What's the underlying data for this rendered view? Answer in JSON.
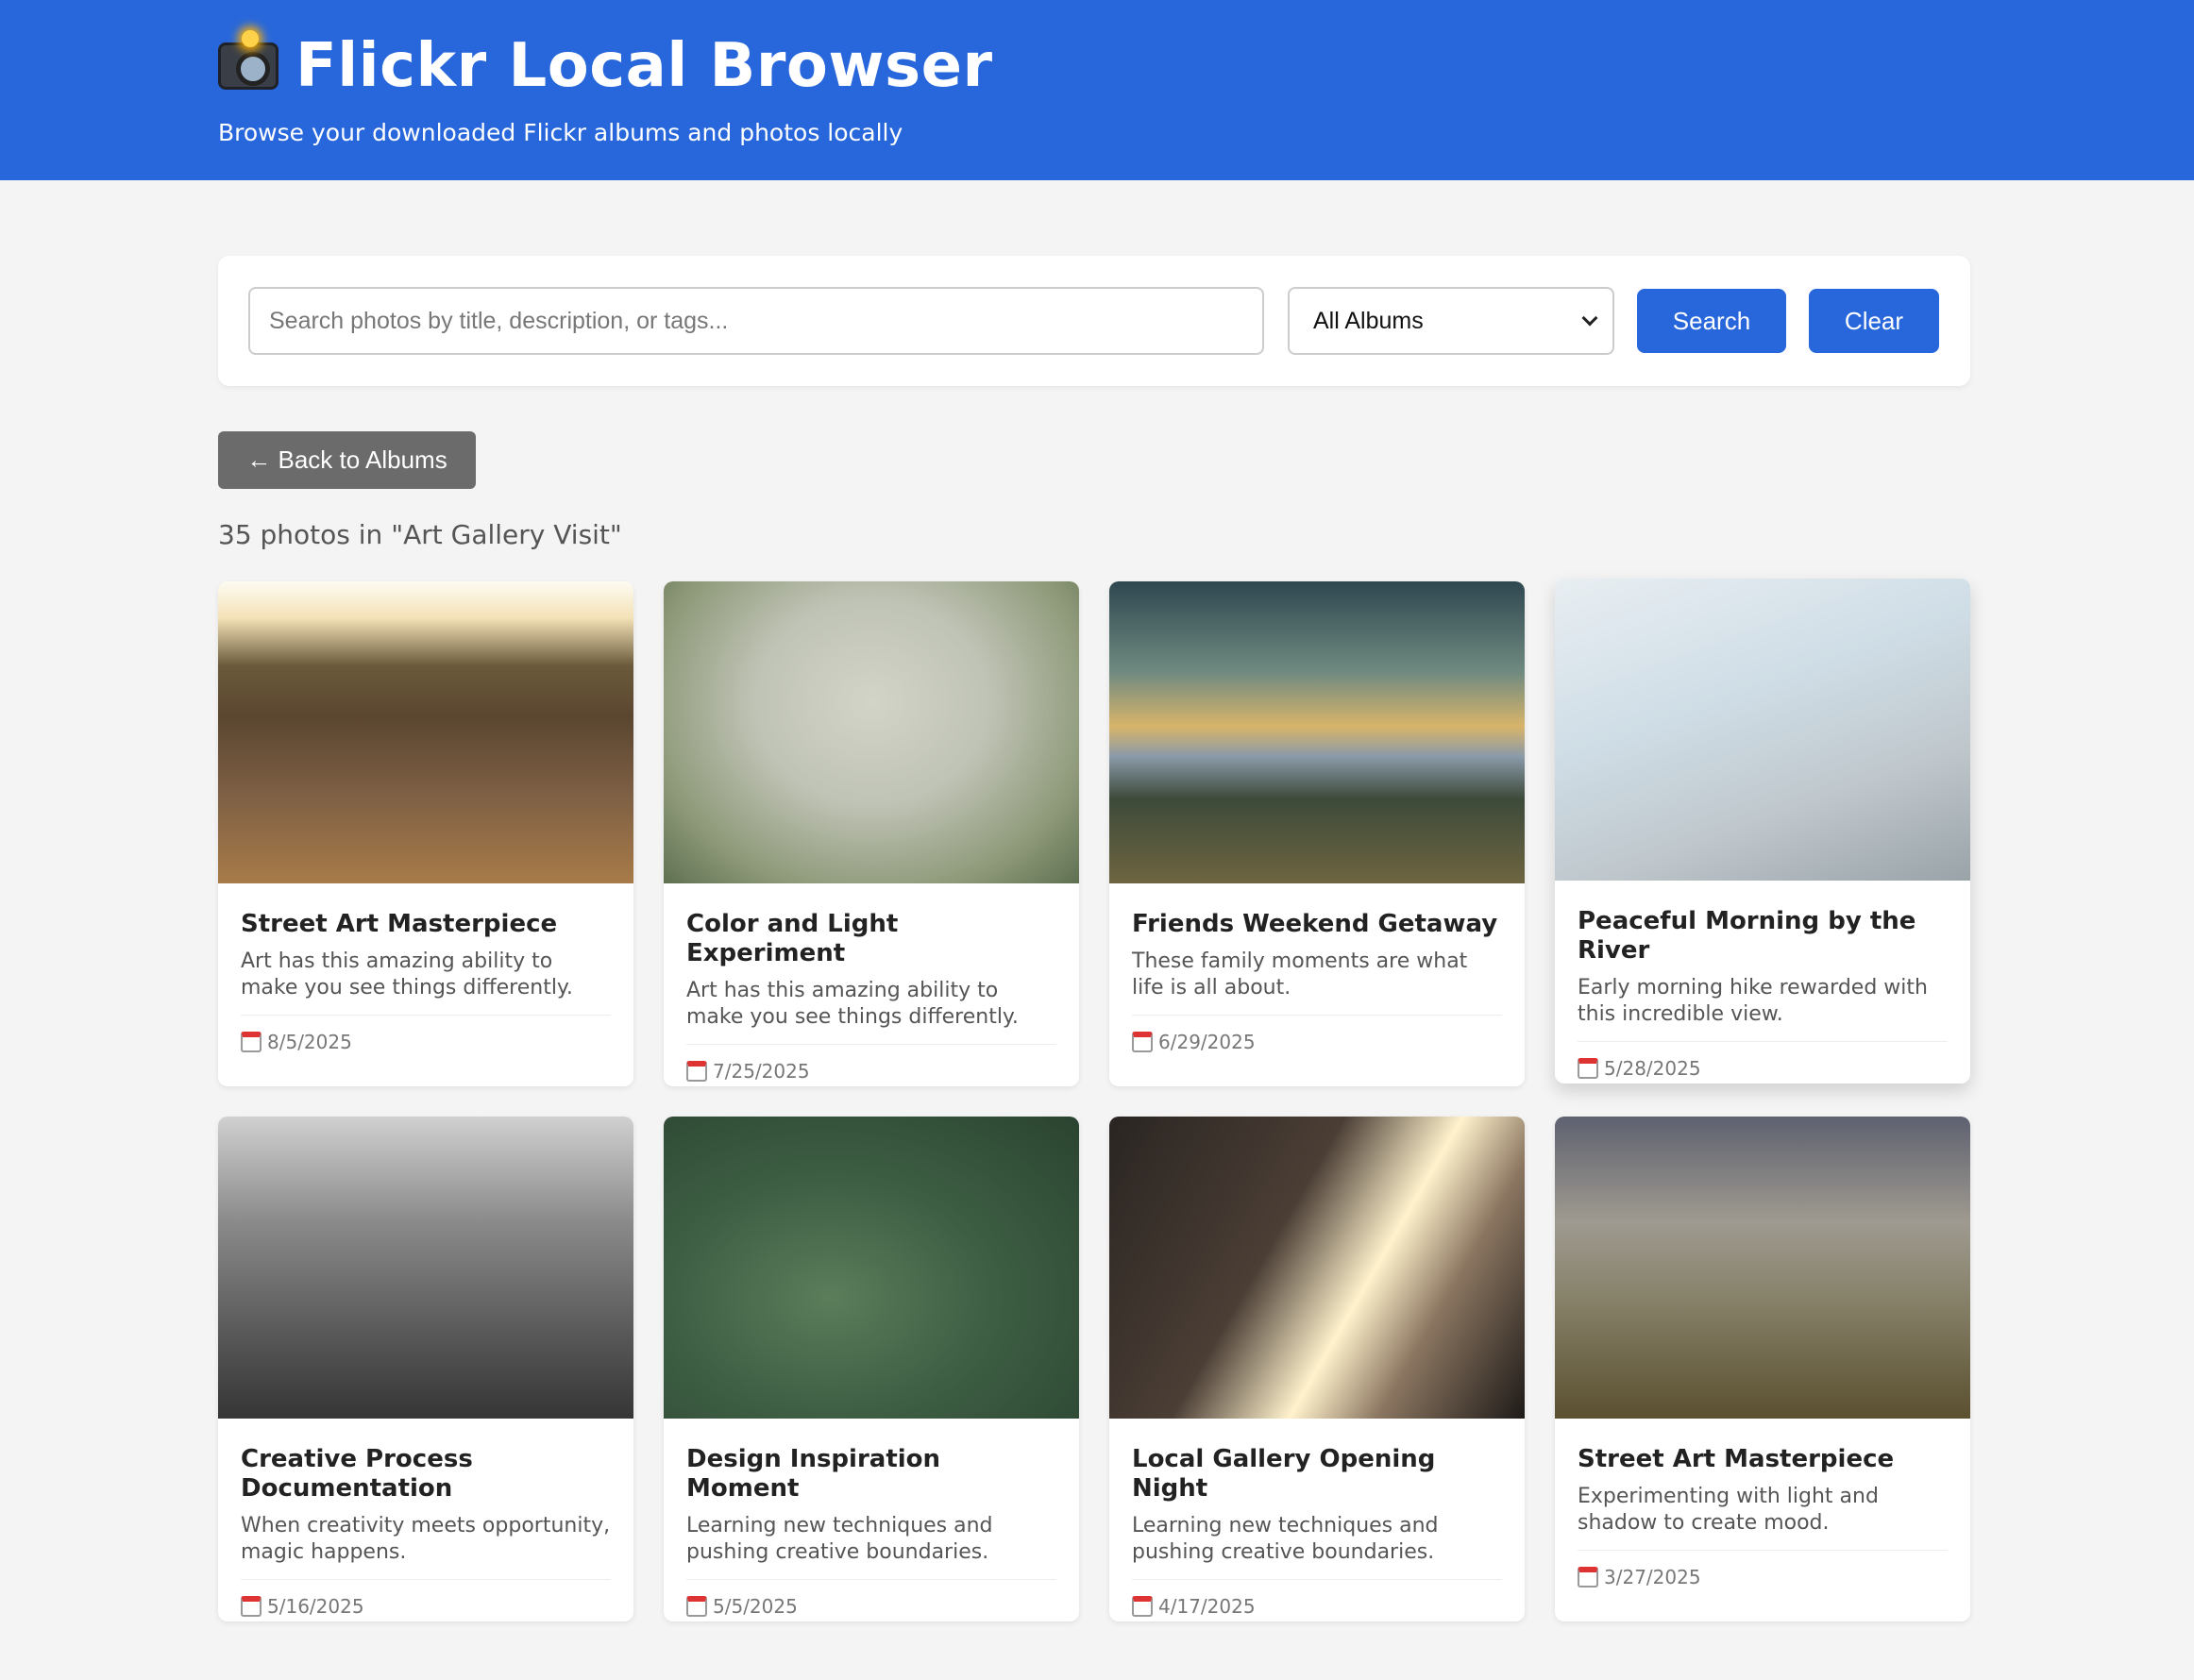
{
  "header": {
    "title": "Flickr Local Browser",
    "subtitle": "Browse your downloaded Flickr albums and photos locally",
    "icon": "camera-flash-icon"
  },
  "search": {
    "placeholder": "Search photos by title, description, or tags...",
    "value": "",
    "album_select": "All Albums",
    "search_label": "Search",
    "clear_label": "Clear"
  },
  "nav": {
    "back_label": "← Back to Albums"
  },
  "summary": "35 photos in \"Art Gallery Visit\"",
  "photos": [
    {
      "title": "Street Art Masterpiece",
      "desc": "Art has this amazing ability to make you see things differently.",
      "date": "8/5/2025"
    },
    {
      "title": "Color and Light Experiment",
      "desc": "Art has this amazing ability to make you see things differently.",
      "date": "7/25/2025"
    },
    {
      "title": "Friends Weekend Getaway",
      "desc": "These family moments are what life is all about.",
      "date": "6/29/2025"
    },
    {
      "title": "Peaceful Morning by the River",
      "desc": "Early morning hike rewarded with this incredible view.",
      "date": "5/28/2025"
    },
    {
      "title": "Creative Process Documentation",
      "desc": "When creativity meets opportunity, magic happens.",
      "date": "5/16/2025"
    },
    {
      "title": "Design Inspiration Moment",
      "desc": "Learning new techniques and pushing creative boundaries.",
      "date": "5/5/2025"
    },
    {
      "title": "Local Gallery Opening Night",
      "desc": "Learning new techniques and pushing creative boundaries.",
      "date": "4/17/2025"
    },
    {
      "title": "Street Art Masterpiece",
      "desc": "Experimenting with light and shadow to create mood.",
      "date": "3/27/2025"
    }
  ],
  "colors": {
    "brand": "#2767db",
    "back_button": "#6b6b6b",
    "background": "#f4f4f4"
  }
}
